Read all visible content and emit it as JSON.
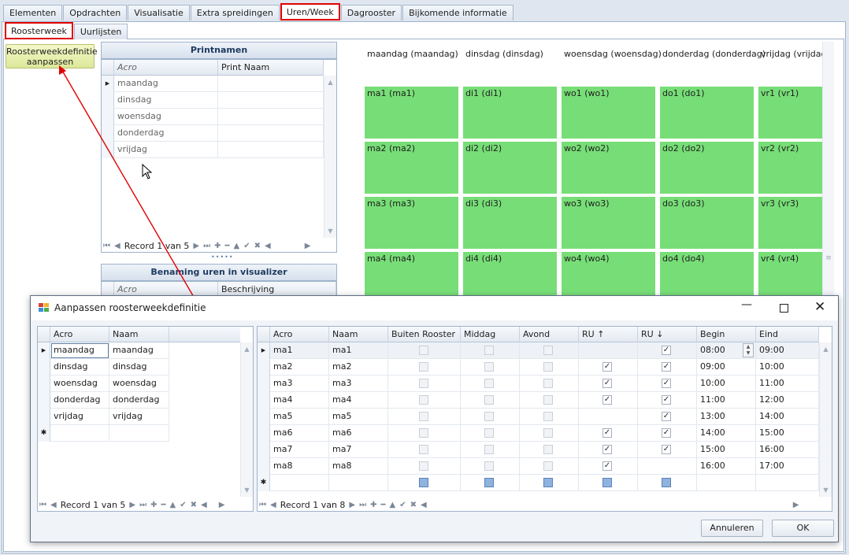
{
  "tabs": [
    "Elementen",
    "Opdrachten",
    "Visualisatie",
    "Extra spreidingen",
    "Uren/Week",
    "Dagrooster",
    "Bijkomende informatie"
  ],
  "subtabs": [
    "Roosterweek",
    "Uurlijsten"
  ],
  "action_button": "Roosterweekdefinitie aanpassen",
  "printnamen": {
    "title": "Printnamen",
    "columns": [
      "Acro",
      "Print Naam"
    ],
    "rows": [
      "maandag",
      "dinsdag",
      "woensdag",
      "donderdag",
      "vrijdag"
    ],
    "record": "Record 1 van 5"
  },
  "benaming": {
    "title": "Benaming uren in visualizer",
    "columns": [
      "Acro",
      "Beschrijving"
    ]
  },
  "schedule": {
    "days": [
      "maandag (maandag)",
      "dinsdag (dinsdag)",
      "woensdag (woensdag)",
      "donderdag (donderdag)",
      "vrijdag (vrijdag)"
    ],
    "blocks": [
      [
        "ma1 (ma1)",
        "di1 (di1)",
        "wo1 (wo1)",
        "do1 (do1)",
        "vr1 (vr1)"
      ],
      [
        "ma2 (ma2)",
        "di2 (di2)",
        "wo2 (wo2)",
        "do2 (do2)",
        "vr2 (vr2)"
      ],
      [
        "ma3 (ma3)",
        "di3 (di3)",
        "wo3 (wo3)",
        "do3 (do3)",
        "vr3 (vr3)"
      ],
      [
        "ma4 (ma4)",
        "di4 (di4)",
        "wo4 (wo4)",
        "do4 (do4)",
        "vr4 (vr4)"
      ]
    ],
    "block_color": "#77de77"
  },
  "dialog": {
    "title": "Aanpassen roosterweekdefinitie",
    "days_grid": {
      "columns": [
        "Acro",
        "Naam"
      ],
      "rows": [
        [
          "maandag",
          "maandag"
        ],
        [
          "dinsdag",
          "dinsdag"
        ],
        [
          "woensdag",
          "woensdag"
        ],
        [
          "donderdag",
          "donderdag"
        ],
        [
          "vrijdag",
          "vrijdag"
        ]
      ],
      "record": "Record 1 van 5"
    },
    "hours_grid": {
      "columns": [
        "Acro",
        "Naam",
        "Buiten Rooster",
        "Middag",
        "Avond",
        "RU ↑",
        "RU ↓",
        "Begin",
        "Eind"
      ],
      "rows": [
        {
          "acro": "ma1",
          "naam": "ma1",
          "ru_up": false,
          "ru_down": true,
          "begin": "08:00",
          "eind": "09:00"
        },
        {
          "acro": "ma2",
          "naam": "ma2",
          "ru_up": true,
          "ru_down": true,
          "begin": "09:00",
          "eind": "10:00"
        },
        {
          "acro": "ma3",
          "naam": "ma3",
          "ru_up": true,
          "ru_down": true,
          "begin": "10:00",
          "eind": "11:00"
        },
        {
          "acro": "ma4",
          "naam": "ma4",
          "ru_up": true,
          "ru_down": true,
          "begin": "11:00",
          "eind": "12:00"
        },
        {
          "acro": "ma5",
          "naam": "ma5",
          "ru_up": false,
          "ru_down": true,
          "begin": "13:00",
          "eind": "14:00"
        },
        {
          "acro": "ma6",
          "naam": "ma6",
          "ru_up": true,
          "ru_down": true,
          "begin": "14:00",
          "eind": "15:00"
        },
        {
          "acro": "ma7",
          "naam": "ma7",
          "ru_up": true,
          "ru_down": true,
          "begin": "15:00",
          "eind": "16:00"
        },
        {
          "acro": "ma8",
          "naam": "ma8",
          "ru_up": true,
          "ru_down": false,
          "begin": "16:00",
          "eind": "17:00"
        }
      ],
      "record": "Record 1 van 8"
    },
    "cancel": "Annuleren",
    "ok": "OK"
  },
  "colors": {
    "highlight": "#e00000",
    "arrow": "#e00000"
  }
}
